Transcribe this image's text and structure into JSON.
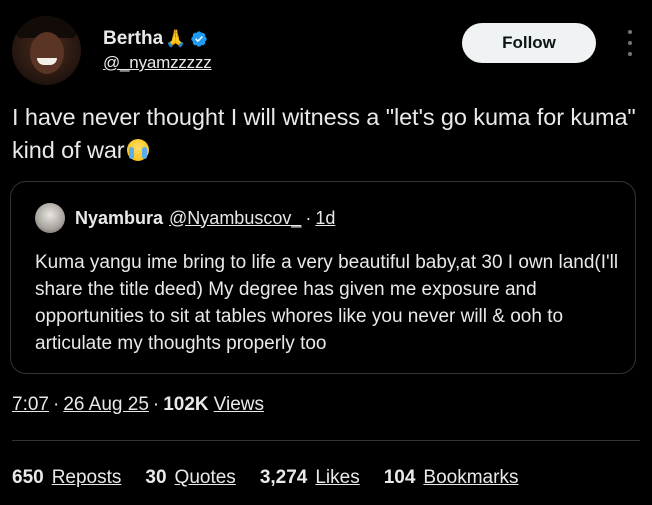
{
  "author": {
    "display_name": "Bertha",
    "name_emoji": "🙏",
    "handle": "@_nyamzzzzz",
    "verified": true,
    "verified_color": "#1d9bf0",
    "avatar_icon": "user-photo"
  },
  "actions": {
    "follow_label": "Follow",
    "more_icon": "more-vertical-icon"
  },
  "tweet": {
    "text": "I have never thought I will witness a \"let's go kuma for kuma\" kind of war",
    "emoji": "😭"
  },
  "quote": {
    "name": "Nyambura",
    "handle": "@Nyambuscov_",
    "separator": "·",
    "time": "1d",
    "text": "Kuma yangu ime bring to life a very beautiful baby,at 30 I own land(I'll share the title deed) My degree has given me exposure and opportunities to sit at tables whores like you never will & ooh to articulate my thoughts properly too"
  },
  "meta": {
    "time": "7:07",
    "date": "26 Aug 25",
    "separator": "·",
    "views_count": "102K",
    "views_label": "Views"
  },
  "stats": [
    {
      "count": "650",
      "label": "Reposts"
    },
    {
      "count": "30",
      "label": "Quotes"
    },
    {
      "count": "3,274",
      "label": "Likes"
    },
    {
      "count": "104",
      "label": "Bookmarks"
    }
  ],
  "colors": {
    "background": "#000000",
    "text": "#e7e9ea",
    "border": "#2f3336",
    "follow_bg": "#eff3f4",
    "follow_text": "#0f1419"
  }
}
